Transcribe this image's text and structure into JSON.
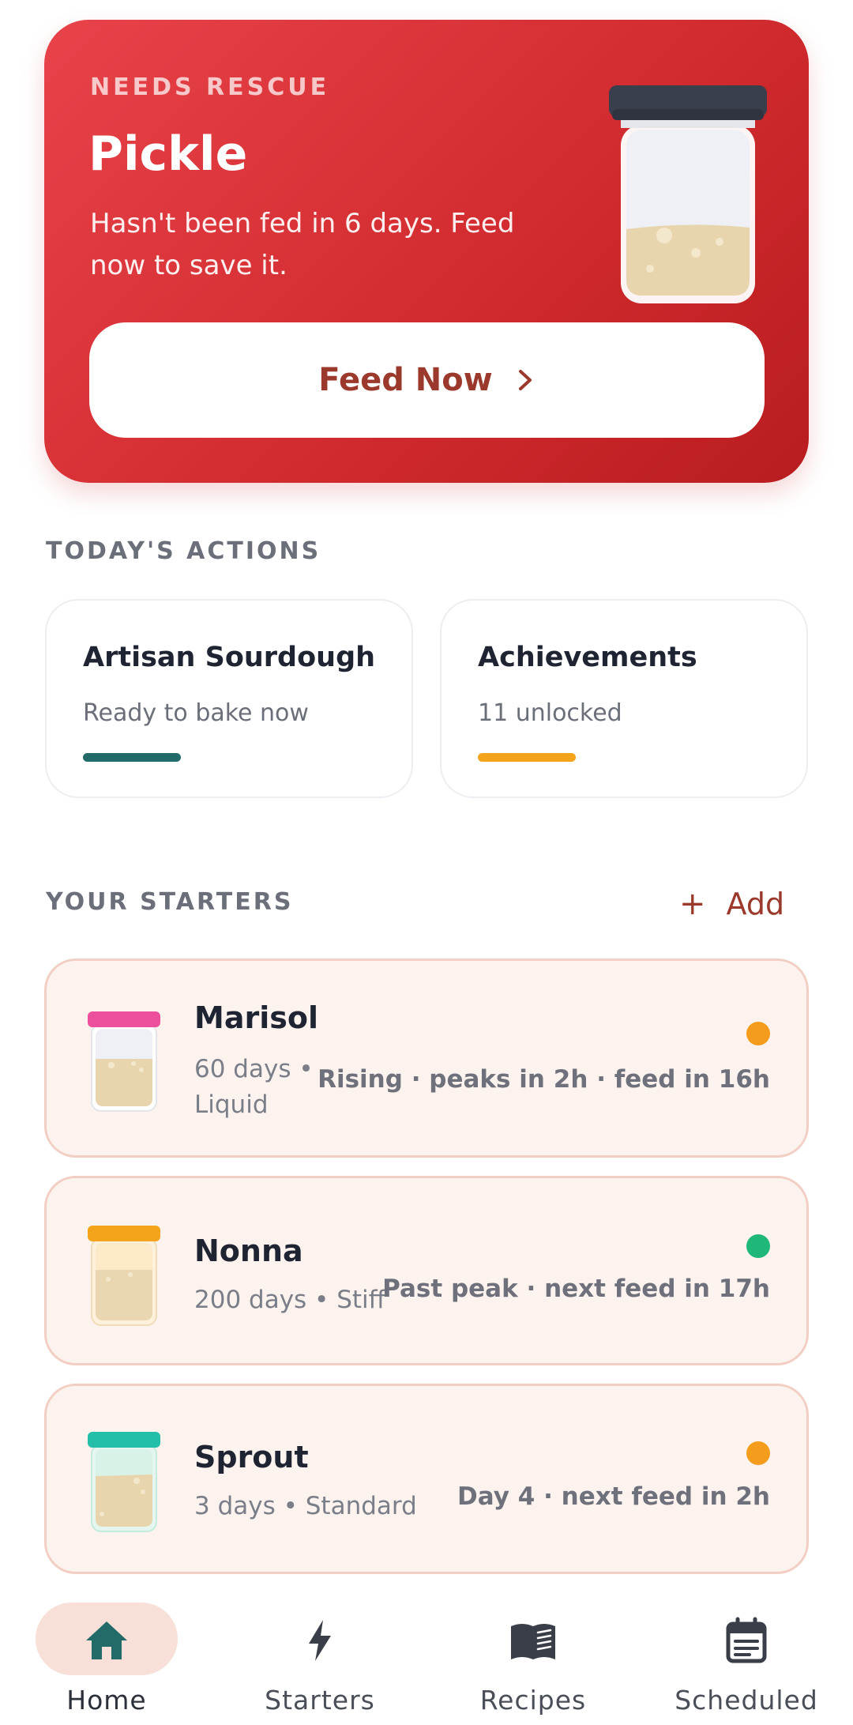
{
  "rescue": {
    "eyebrow": "NEEDS RESCUE",
    "title": "Pickle",
    "description": "Hasn't been fed in 6 days. Feed now to save it.",
    "button_label": "Feed Now",
    "jar_icon": "jar-icon"
  },
  "actions": {
    "heading": "TODAY'S ACTIONS",
    "cards": [
      {
        "title": "Artisan Sourdough",
        "subtitle": "Ready to bake now",
        "accent": "#236b68"
      },
      {
        "title": "Achievements",
        "subtitle": "11 unlocked",
        "accent": "#f4a41b"
      }
    ]
  },
  "starters": {
    "heading": "YOUR STARTERS",
    "add_label": "Add",
    "items": [
      {
        "name": "Marisol",
        "meta": "60 days •\nLiquid",
        "status": "Rising · peaks in 2h · feed in 16h",
        "dot_color": "#f49d1c",
        "lid_color": "#ec4f9c"
      },
      {
        "name": "Nonna",
        "meta": "200 days • Stiff",
        "status": "Past peak · next feed in 17h",
        "dot_color": "#1fb879",
        "lid_color": "#f4a41b"
      },
      {
        "name": "Sprout",
        "meta": "3 days • Standard",
        "status": "Day 4 · next feed in 2h",
        "dot_color": "#f49d1c",
        "lid_color": "#23bfa8"
      }
    ]
  },
  "nav": {
    "items": [
      {
        "label": "Home",
        "icon": "home-icon",
        "active": true
      },
      {
        "label": "Starters",
        "icon": "lightning-icon",
        "active": false
      },
      {
        "label": "Recipes",
        "icon": "book-icon",
        "active": false
      },
      {
        "label": "Scheduled",
        "icon": "calendar-icon",
        "active": false
      }
    ]
  },
  "colors": {
    "brand_red": "#d22c30",
    "accent_text": "#9b3a2c",
    "teal": "#236b68",
    "starter_bg": "#fcf3ef",
    "nav_active_bg": "#f8dfd7"
  }
}
